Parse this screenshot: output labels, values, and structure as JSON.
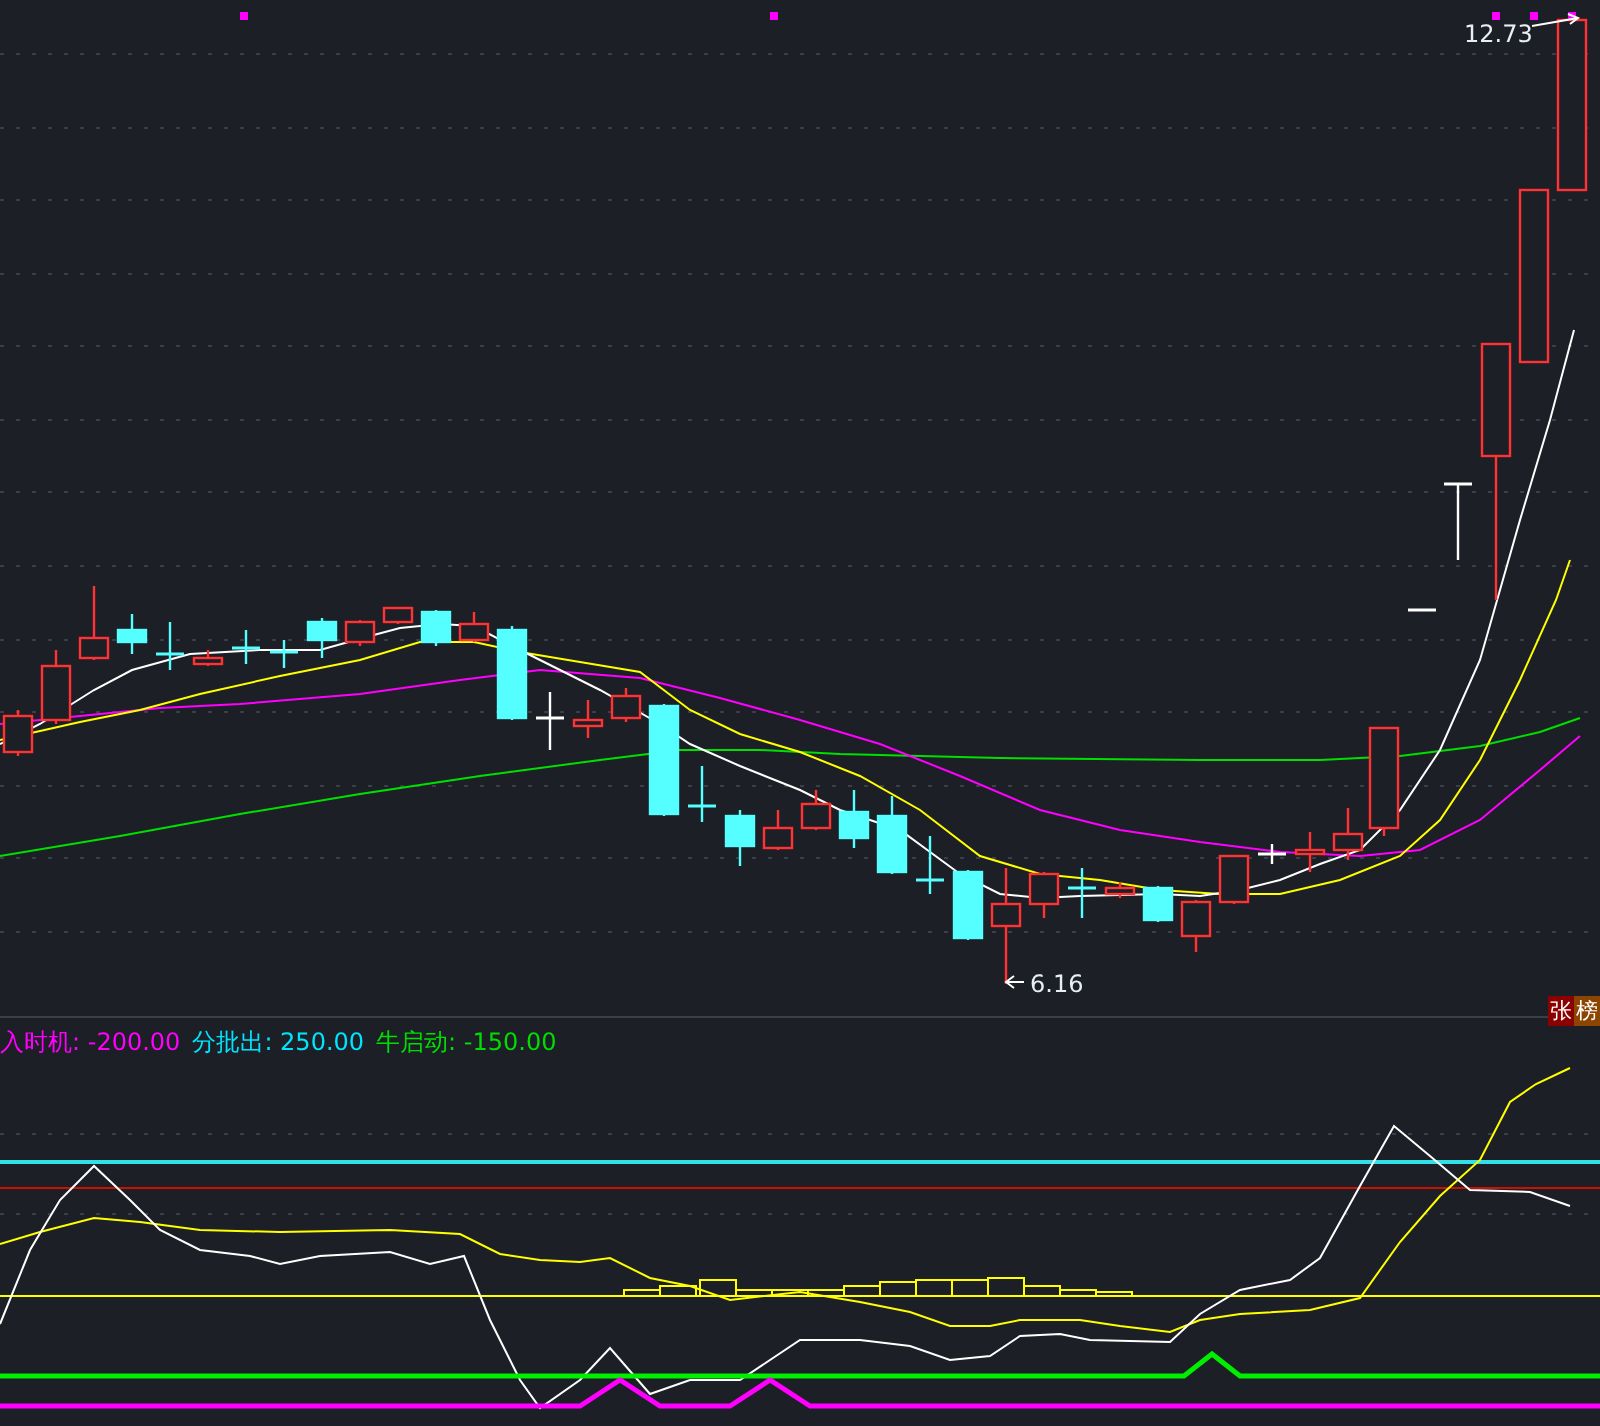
{
  "price_chart": {
    "high_label": "12.73",
    "low_label": "6.16",
    "badges": [
      {
        "text": "张",
        "color": "#8b0000"
      },
      {
        "text": "榜",
        "color": "#8b4500"
      }
    ]
  },
  "indicator": {
    "legend": [
      {
        "text": "入时机: -200.00",
        "color": "#ff00ff"
      },
      {
        "text": "分批出: 250.00",
        "color": "#00e5ff"
      },
      {
        "text": "牛启动: -150.00",
        "color": "#00dd00"
      }
    ]
  }
}
